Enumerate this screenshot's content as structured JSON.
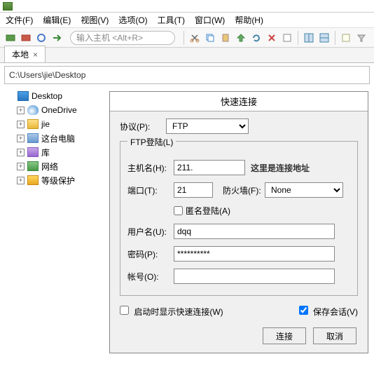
{
  "menus": {
    "file": "文件(F)",
    "edit": "编辑(E)",
    "view": "视图(V)",
    "options": "选项(O)",
    "tools": "工具(T)",
    "window": "窗口(W)",
    "help": "帮助(H)"
  },
  "toolbar": {
    "host_placeholder": "输入主机 <Alt+R>"
  },
  "tabs": {
    "local": "本地",
    "close": "×"
  },
  "path": "C:\\Users\\jie\\Desktop",
  "tree": {
    "desktop": "Desktop",
    "items": [
      {
        "label": "OneDrive",
        "icon": "ic-cloud"
      },
      {
        "label": "jie",
        "icon": "ic-folder"
      },
      {
        "label": "这台电脑",
        "icon": "ic-pc"
      },
      {
        "label": "库",
        "icon": "ic-lib"
      },
      {
        "label": "网络",
        "icon": "ic-net"
      },
      {
        "label": "等级保护",
        "icon": "ic-shield"
      }
    ]
  },
  "dialog": {
    "title": "快速连接",
    "protocol_label": "协议(P):",
    "protocol_value": "FTP",
    "fieldset": "FTP登陆(L)",
    "host_label": "主机名(H):",
    "host_value": "211.",
    "host_annot": "这里是连接地址",
    "port_label": "端口(T):",
    "port_value": "21",
    "firewall_label": "防火墙(F):",
    "firewall_value": "None",
    "anon_label": "匿名登陆(A)",
    "user_label": "用户名(U):",
    "user_value": "dqq",
    "pass_label": "密码(P):",
    "pass_value": "**********",
    "acct_label": "帐号(O):",
    "acct_value": "",
    "show_startup": "启动时显示快速连接(W)",
    "save_session": "保存会话(V)",
    "connect": "连接",
    "cancel": "取消"
  }
}
